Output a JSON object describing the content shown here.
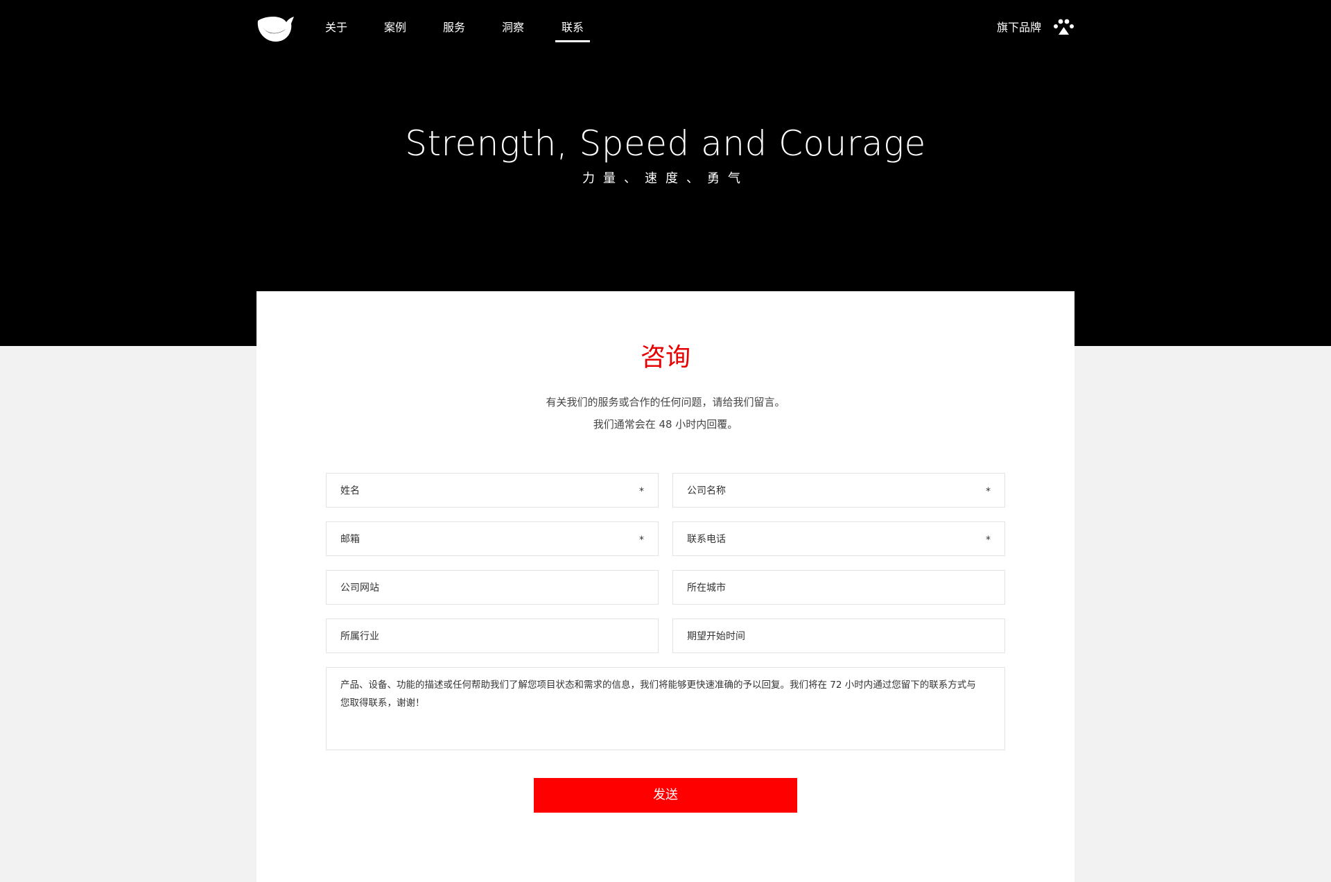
{
  "nav": {
    "items": [
      {
        "label": "关于"
      },
      {
        "label": "案例"
      },
      {
        "label": "服务"
      },
      {
        "label": "洞察"
      },
      {
        "label": "联系",
        "active": true
      }
    ],
    "brands_label": "旗下品牌"
  },
  "hero": {
    "title": "Strength, Speed and Courage",
    "subtitle": "力量、速度、勇气"
  },
  "form": {
    "title": "咨询",
    "intro_line1": "有关我们的服务或合作的任何问题，请给我们留言。",
    "intro_line2": "我们通常会在 48 小时内回覆。",
    "fields": {
      "name": {
        "placeholder": "姓名",
        "required_mark": "*"
      },
      "company": {
        "placeholder": "公司名称",
        "required_mark": "*"
      },
      "email": {
        "placeholder": "邮箱",
        "required_mark": "*"
      },
      "phone": {
        "placeholder": "联系电话",
        "required_mark": "*"
      },
      "website": {
        "placeholder": "公司网站"
      },
      "city": {
        "placeholder": "所在城市"
      },
      "industry": {
        "placeholder": "所属行业"
      },
      "start_time": {
        "placeholder": "期望开始时间"
      }
    },
    "message_placeholder": "产品、设备、功能的描述或任何帮助我们了解您项目状态和需求的信息，我们将能够更快速准确的予以回复。我们将在 72 小时内通过您留下的联系方式与您取得联系，谢谢！",
    "submit_label": "发送"
  },
  "colors": {
    "accent": "#ff0000",
    "title_red": "#e60000",
    "hero_bg": "#000000",
    "page_bg": "#f2f2f2"
  },
  "icons": {
    "logo": "brand-logo",
    "brands": "paw-icon"
  }
}
